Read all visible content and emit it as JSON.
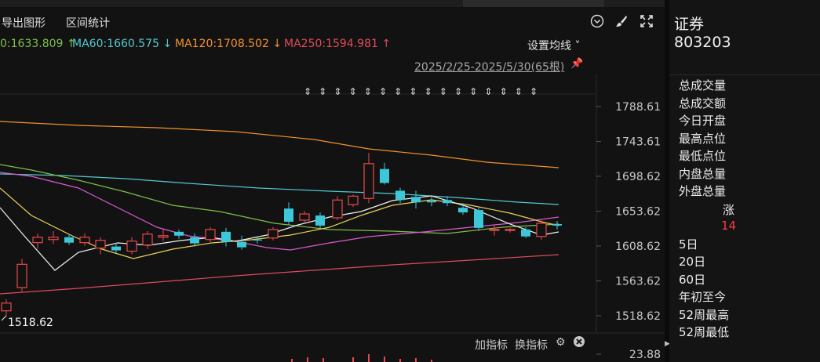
{
  "toolbar": {
    "export_label": "导出图形",
    "range_stats_label": "区间统计",
    "icons": [
      "chevron-circle-icon",
      "brush-icon",
      "fullscreen-icon"
    ]
  },
  "ma_legend": [
    {
      "text": "0:1633.809",
      "arrow": "↑",
      "color": "#7cc04a"
    },
    {
      "text": "MA60:1660.575",
      "arrow": "↓",
      "color": "#55c8d0"
    },
    {
      "text": "MA120:1708.502",
      "arrow": "↓",
      "color": "#f0922a"
    },
    {
      "text": "MA250:1594.981",
      "arrow": "↑",
      "color": "#e04a5e"
    }
  ],
  "set_ma_label": "设置均线 ˅",
  "date_range": "2025/2/25-2025/5/30(65根)",
  "price_axis": [
    "1788.61",
    "1743.61",
    "1698.62",
    "1653.62",
    "1608.62",
    "1563.62",
    "1518.62"
  ],
  "low_marker": "1518.62",
  "volume_axis_top": "23.88",
  "bottom": {
    "add_indicator": "加指标",
    "switch_indicator": "换指标"
  },
  "colors": {
    "up": "#e84a4a",
    "down": "#3cc8d8",
    "bg": "#121212"
  },
  "panel": {
    "title": "证券",
    "code": "803203",
    "items": [
      "总成交量",
      "总成交额",
      "今日开盘",
      "最高点位",
      "最低点位",
      "内盘总量",
      "外盘总量"
    ],
    "rise_label": "涨",
    "rise_value": "14",
    "periods": [
      "5日",
      "20日",
      "60日",
      "年初至今",
      "52周最高",
      "52周最低"
    ]
  }
}
